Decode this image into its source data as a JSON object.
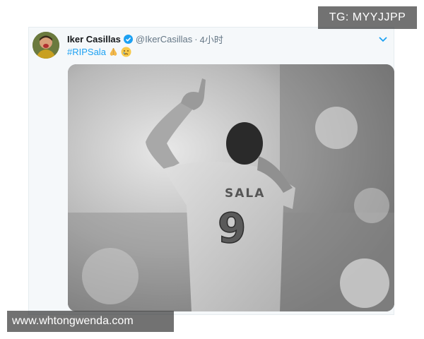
{
  "tweet": {
    "display_name": "Iker Casillas",
    "handle": "@IkerCasillas",
    "separator": "·",
    "time": "4小时",
    "hashtag": "#RIPSala",
    "emojis": [
      "folded-hands-emoji",
      "crying-face-emoji"
    ],
    "verified": true,
    "colors": {
      "link": "#1da1f2",
      "name": "#14171a",
      "meta": "#657786",
      "card_bg": "#f5f8fa"
    }
  },
  "photo": {
    "jersey_name": "SALA",
    "jersey_number": "9",
    "style": "grayscale"
  },
  "watermarks": {
    "top_right": "TG: MYYJJPP",
    "bottom_left": "www.whtongwenda.com"
  }
}
